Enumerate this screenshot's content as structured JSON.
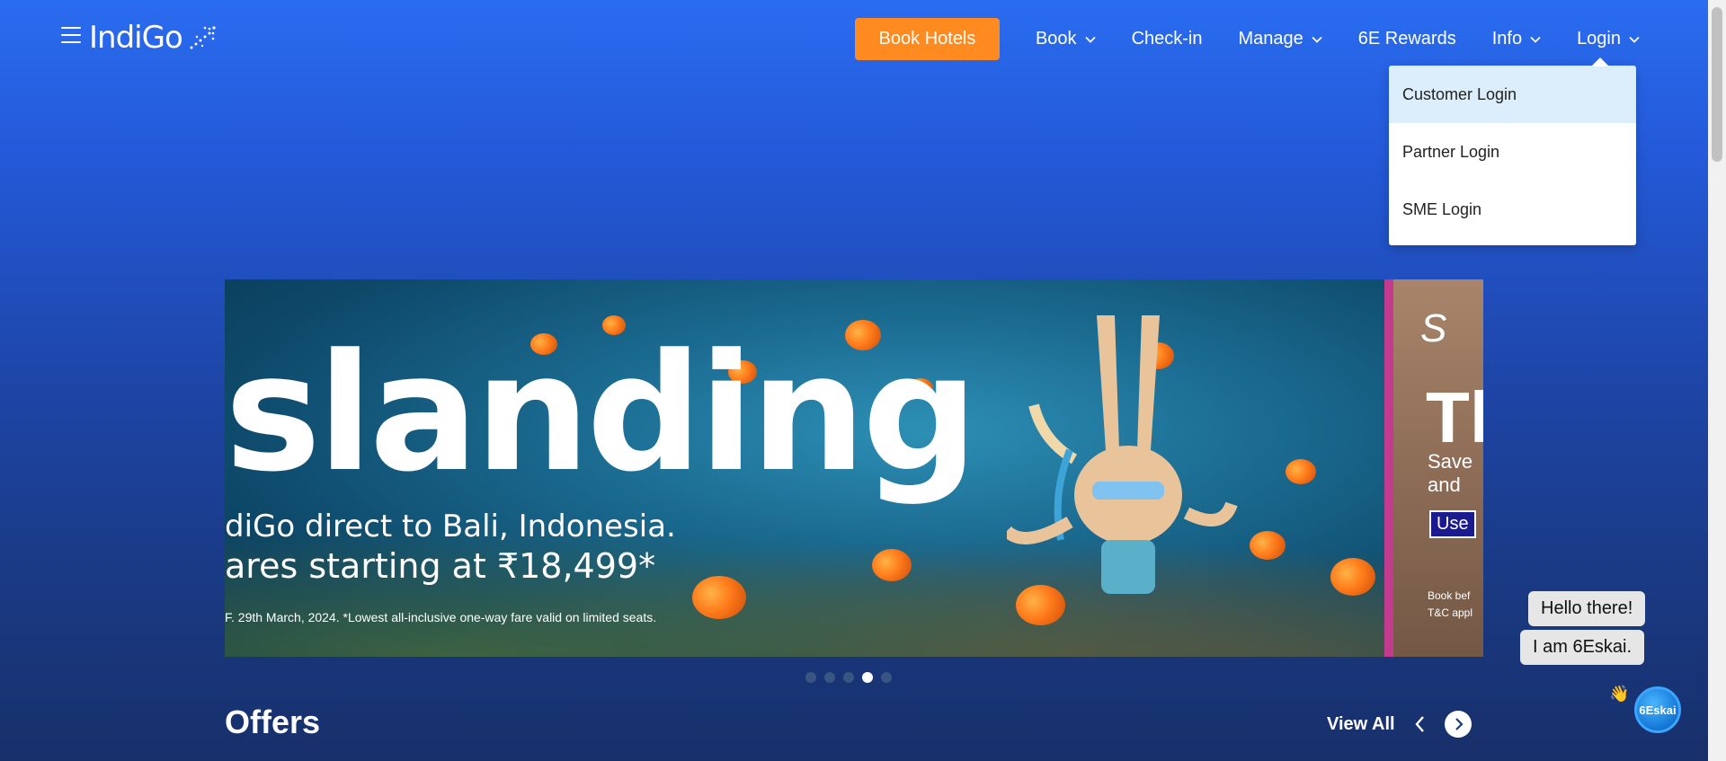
{
  "header": {
    "logo_text": "IndiGo",
    "nav": {
      "book_hotels": "Book Hotels",
      "book": "Book",
      "checkin": "Check-in",
      "manage": "Manage",
      "rewards": "6E Rewards",
      "info": "Info",
      "login": "Login"
    }
  },
  "login_dropdown": {
    "items": [
      "Customer Login",
      "Partner Login",
      "SME Login"
    ]
  },
  "banner": {
    "title": "slanding",
    "line1": "diGo direct to Bali, Indonesia.",
    "line2": "ares starting at ₹18,499*",
    "fine_print": "F. 29th March, 2024. *Lowest all-inclusive one-way fare valid on limited seats.",
    "next_slide": {
      "top_text": "S",
      "big_text": "Th",
      "save_line1": "Save",
      "save_line2": "and",
      "use_text": "Use",
      "fine_line1": "Book bef",
      "fine_line2": "T&C appl"
    }
  },
  "carousel": {
    "count": 5,
    "active_index": 3
  },
  "offers": {
    "title": "Offers",
    "view_all": "View All"
  },
  "chat": {
    "bubble1": "Hello there!",
    "bubble2": "I am 6Eskai.",
    "avatar_label": "6Eskai",
    "wave": "👋"
  },
  "colors": {
    "accent_orange": "#ff8a1f",
    "dropdown_active": "#dcedfb",
    "bg_top": "#2a6cf0",
    "bg_bottom": "#18306a"
  }
}
